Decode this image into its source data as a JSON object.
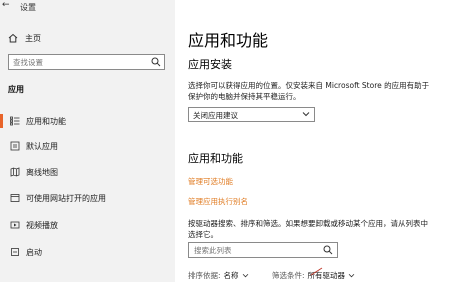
{
  "window": {
    "title": "设置"
  },
  "sidebar": {
    "home_label": "主页",
    "search_placeholder": "查找设置",
    "section_label": "应用",
    "items": [
      {
        "label": "应用和功能",
        "icon": "apps-list-icon",
        "selected": true
      },
      {
        "label": "默认应用",
        "icon": "default-apps-icon",
        "selected": false
      },
      {
        "label": "离线地图",
        "icon": "offline-maps-icon",
        "selected": false
      },
      {
        "label": "可使用网站打开的应用",
        "icon": "apps-for-websites-icon",
        "selected": false
      },
      {
        "label": "视频播放",
        "icon": "video-playback-icon",
        "selected": false
      },
      {
        "label": "启动",
        "icon": "startup-icon",
        "selected": false
      }
    ]
  },
  "main": {
    "title": "应用和功能",
    "install": {
      "heading": "应用安装",
      "desc_line1": "选择你可以获得应用的位置。仅安装来自 Microsoft Store 的应用有助于",
      "desc_line2": "保护你的电脑并保持其平稳运行。",
      "dropdown_value": "关闭应用建议"
    },
    "apps": {
      "heading": "应用和功能",
      "link_optional": "管理可选功能",
      "link_alias": "管理应用执行别名",
      "desc_line1": "按驱动器搜索、排序和筛选。如果想要卸载或移动某个应用，请从列表中",
      "desc_line2": "选择它。",
      "search_placeholder": "搜索此列表",
      "sort_label": "排序依据:",
      "sort_value": "名称",
      "filter_label": "筛选条件:",
      "filter_value": "所有驱动器"
    }
  },
  "colors": {
    "accent": "#e8642a",
    "link": "#e07b22",
    "sidebar_bg": "#f2f2f2"
  }
}
